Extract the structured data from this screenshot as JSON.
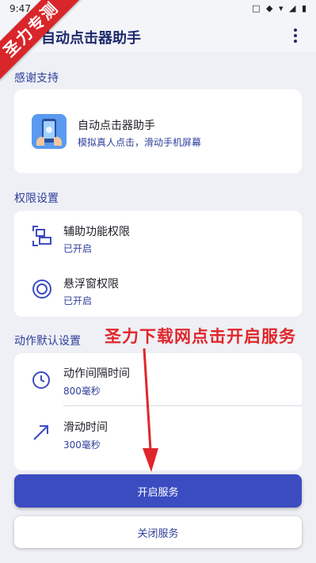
{
  "status_bar": {
    "time": "9:47",
    "icons": "□ ◆ ▾ ◢ ▮"
  },
  "app_bar": {
    "title": "自动点击器助手"
  },
  "corner_banner": {
    "text": "圣力专测"
  },
  "sections": {
    "thanks": "感谢支持",
    "permissions": "权限设置",
    "defaults": "动作默认设置"
  },
  "thanks_card": {
    "title": "自动点击器助手",
    "subtitle": "模拟真人点击，滑动手机屏幕"
  },
  "permissions_card": [
    {
      "title": "辅助功能权限",
      "status": "已开启",
      "icon": "accessibility-scan-icon"
    },
    {
      "title": "悬浮窗权限",
      "status": "已开启",
      "icon": "floating-circle-icon"
    }
  ],
  "defaults_card": [
    {
      "title": "动作间隔时间",
      "value": "800毫秒",
      "icon": "clock-icon"
    },
    {
      "title": "滑动时间",
      "value": "300毫秒",
      "icon": "arrow-diagonal-icon"
    }
  ],
  "buttons": {
    "start": "开启服务",
    "stop": "关闭服务"
  },
  "overlay": {
    "text": "圣力下载网点击开启服务"
  },
  "colors": {
    "accent": "#3b4cc0",
    "section_text": "#2e3f9a",
    "overlay_red": "#e0262b",
    "background": "#eef0f5"
  }
}
